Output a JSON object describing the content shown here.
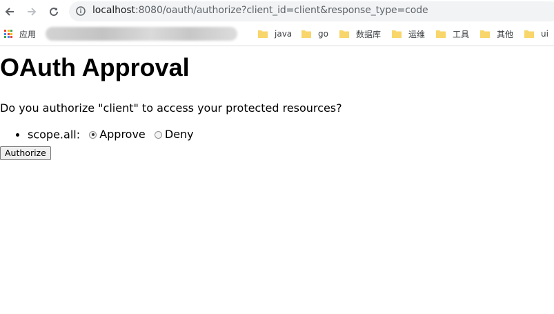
{
  "browser": {
    "url_host": "localhost",
    "url_rest": ":8080/oauth/authorize?client_id=client&response_type=code",
    "bookmarks": {
      "apps_label": "应用",
      "folders": [
        "java",
        "go",
        "数据库",
        "运维",
        "工具",
        "其他",
        "ui"
      ]
    }
  },
  "page": {
    "title": "OAuth Approval",
    "question": "Do you authorize \"client\" to access your protected resources?",
    "scope": {
      "label": "scope.all:",
      "options": [
        "Approve",
        "Deny"
      ],
      "selected": "Approve"
    },
    "authorize_label": "Authorize"
  },
  "colors": {
    "folder": "#f8d66b",
    "apps_grid": [
      "#ea4335",
      "#fbbc05",
      "#34a853",
      "#4285f4"
    ]
  }
}
